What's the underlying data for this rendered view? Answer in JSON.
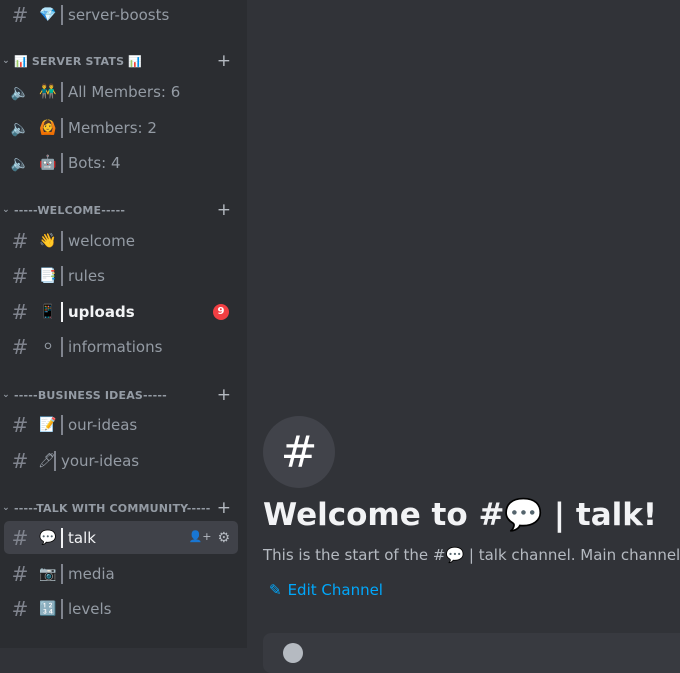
{
  "sidebar": {
    "top_channel": {
      "emoji": "💎",
      "name": "server-boosts",
      "type": "text"
    },
    "categories": [
      {
        "name": "📊 SERVER STATS 📊",
        "channels": [
          {
            "emoji": "👬",
            "name": "All Members: 6",
            "type": "locked-voice"
          },
          {
            "emoji": "🙆",
            "name": "Members: 2",
            "type": "locked-voice"
          },
          {
            "emoji": "🤖",
            "name": "Bots: 4",
            "type": "locked-voice"
          }
        ]
      },
      {
        "name": "-----WELCOME-----",
        "channels": [
          {
            "emoji": "👋",
            "name": "welcome",
            "type": "text"
          },
          {
            "emoji": "📑",
            "name": "rules",
            "type": "text"
          },
          {
            "emoji": "📱",
            "name": "uploads",
            "type": "text",
            "unread": true,
            "mentions": "9"
          },
          {
            "emoji": "⚪",
            "name": "informations",
            "type": "text"
          }
        ]
      },
      {
        "name": "-----BUSINESS IDEAS-----",
        "channels": [
          {
            "emoji": "📝",
            "name": "our-ideas",
            "type": "text"
          },
          {
            "emoji": "🖊",
            "name": "your-ideas",
            "type": "text"
          }
        ]
      },
      {
        "name": "-----TALK WITH COMMUNITY-----",
        "channels": [
          {
            "emoji": "💬",
            "name": "talk",
            "type": "text",
            "active": true
          },
          {
            "emoji": "📷",
            "name": "media",
            "type": "text"
          },
          {
            "emoji": "🔢",
            "name": "levels",
            "type": "text"
          }
        ]
      }
    ],
    "icons": {
      "text": "#",
      "voice": "🔈",
      "plus": "+",
      "chevron": "⌄",
      "invite": "👤+",
      "settings": "⚙"
    }
  },
  "main": {
    "welcome_icon": "#",
    "welcome_title": "Welcome to #💬 | talk!",
    "welcome_subtitle": "This is the start of the #💬 | talk channel. Main channel",
    "edit_channel_label": "Edit Channel",
    "edit_icon": "✎"
  },
  "colors": {
    "sidebar_bg": "#2b2d31",
    "main_bg": "#313338",
    "link": "#00a8fc",
    "mention_badge": "#f23f43",
    "active_channel_bg": "#404249"
  }
}
